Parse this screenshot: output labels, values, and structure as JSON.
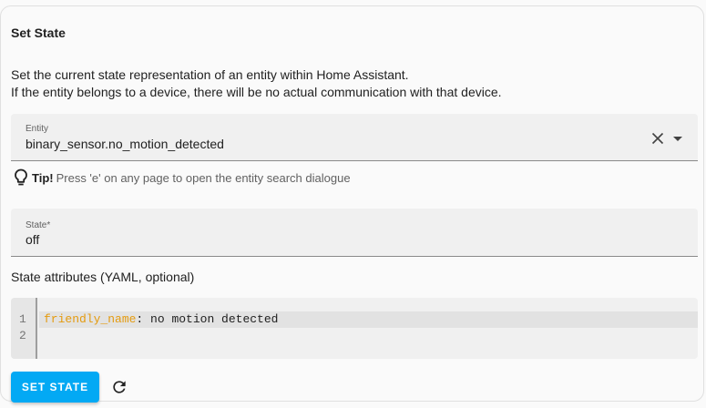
{
  "card": {
    "title": "Set State",
    "description_line1": "Set the current state representation of an entity within Home Assistant.",
    "description_line2": "If the entity belongs to a device, there will be no actual communication with that device."
  },
  "entity": {
    "label": "Entity",
    "value": "binary_sensor.no_motion_detected",
    "clear_icon": "close-icon",
    "dropdown_icon": "chevron-down-icon"
  },
  "tip": {
    "icon": "lightbulb-icon",
    "label": "Tip!",
    "text": "Press 'e' on any page to open the entity search dialogue"
  },
  "state": {
    "label": "State*",
    "value": "off"
  },
  "attributes": {
    "label": "State attributes (YAML, optional)",
    "line_numbers": [
      "1",
      "2"
    ],
    "lines": [
      {
        "key": "friendly_name",
        "sep": ":",
        "value": " no motion detected"
      },
      {
        "key": "",
        "sep": "",
        "value": ""
      }
    ]
  },
  "actions": {
    "set_state_label": "SET STATE",
    "refresh_icon": "refresh-icon"
  },
  "colors": {
    "primary": "#03a9f4",
    "yaml_key": "#e49b0f"
  }
}
